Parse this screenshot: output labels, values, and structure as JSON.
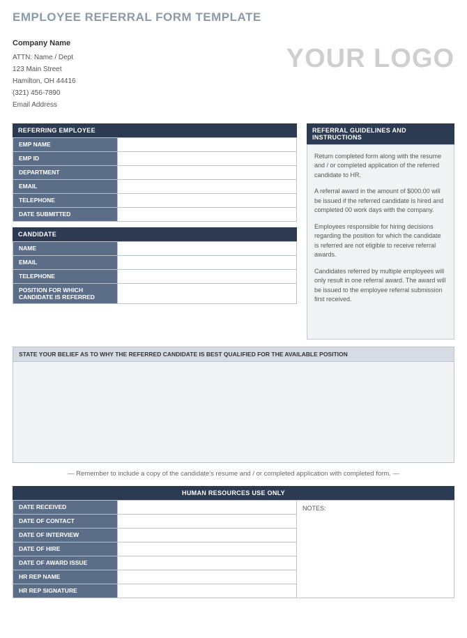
{
  "title": "EMPLOYEE REFERRAL FORM TEMPLATE",
  "company": {
    "name": "Company Name",
    "attn": "ATTN: Name / Dept",
    "street": "123 Main Street",
    "city": "Hamilton, OH  44416",
    "phone": "(321) 456-7890",
    "email": "Email Address"
  },
  "logo": "YOUR LOGO",
  "sections": {
    "referring": {
      "header": "REFERRING EMPLOYEE",
      "fields": [
        {
          "label": "EMP NAME",
          "value": ""
        },
        {
          "label": "EMP ID",
          "value": ""
        },
        {
          "label": "DEPARTMENT",
          "value": ""
        },
        {
          "label": "EMAIL",
          "value": ""
        },
        {
          "label": "TELEPHONE",
          "value": ""
        },
        {
          "label": "DATE SUBMITTED",
          "value": ""
        }
      ]
    },
    "candidate": {
      "header": "CANDIDATE",
      "fields": [
        {
          "label": "NAME",
          "value": ""
        },
        {
          "label": "EMAIL",
          "value": ""
        },
        {
          "label": "TELEPHONE",
          "value": ""
        },
        {
          "label": "POSITION FOR WHICH CANDIDATE IS REFERRED",
          "value": ""
        }
      ]
    },
    "guidelines": {
      "header": "REFERRAL GUIDELINES AND INSTRUCTIONS",
      "paragraphs": [
        "Return completed form along with the resume and / or completed application of the referred candidate to HR.",
        "A referral award in the amount of $000.00 will be issued if the referred candidate is hired and completed 00 work days with the company.",
        "Employees responsible for hiring decisions regarding the position for which the candidate is referred are not eligible to receive referral awards.",
        "Candidates referred by multiple employees will only result in one referral award.  The award will be issued to the employee referral submission first received."
      ]
    },
    "statement": {
      "header": "STATE YOUR BELIEF AS TO WHY THE REFERRED CANDIDATE IS BEST QUALIFIED FOR THE AVAILABLE POSITION",
      "value": ""
    },
    "reminder": "— Remember to include a copy of the candidate's resume and / or completed application with completed form. —",
    "hr": {
      "header": "HUMAN RESOURCES USE ONLY",
      "fields": [
        {
          "label": "DATE RECEIVED",
          "value": ""
        },
        {
          "label": "DATE OF CONTACT",
          "value": ""
        },
        {
          "label": "DATE OF INTERVIEW",
          "value": ""
        },
        {
          "label": "DATE OF HIRE",
          "value": ""
        },
        {
          "label": "DATE OF AWARD ISSUE",
          "value": ""
        },
        {
          "label": "HR REP NAME",
          "value": ""
        },
        {
          "label": "HR REP SIGNATURE",
          "value": ""
        }
      ],
      "notes_label": "NOTES:",
      "notes_value": ""
    }
  }
}
